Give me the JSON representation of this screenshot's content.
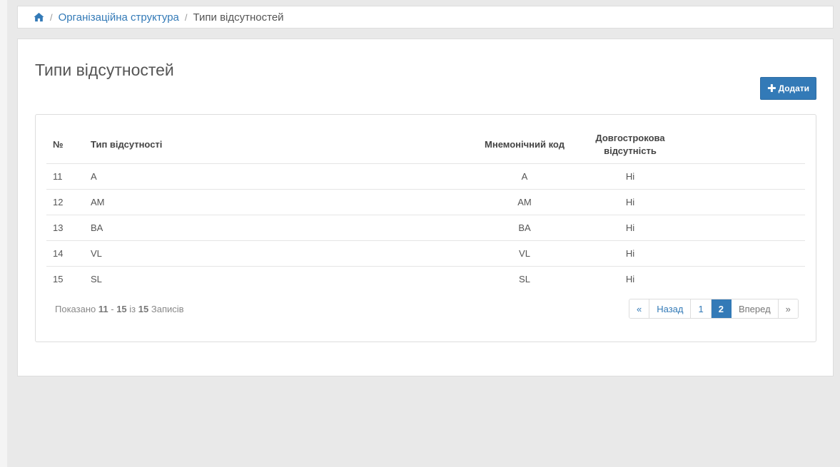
{
  "breadcrumb": {
    "home_icon": "home-icon",
    "separator": "/",
    "items": [
      "Організаційна структура",
      "Типи відсутностей"
    ]
  },
  "page": {
    "title": "Типи відсутностей",
    "add_button": {
      "icon": "plus-icon",
      "label": "Додати"
    }
  },
  "table": {
    "columns": [
      "№",
      "Тип відсутності",
      "Мнемонічний код",
      "Довгострокова відсутність"
    ],
    "rows": [
      [
        "11",
        "A",
        "A",
        "Ні"
      ],
      [
        "12",
        "AM",
        "AM",
        "Ні"
      ],
      [
        "13",
        "BA",
        "BA",
        "Ні"
      ],
      [
        "14",
        "VL",
        "VL",
        "Ні"
      ],
      [
        "15",
        "SL",
        "SL",
        "Ні"
      ]
    ]
  },
  "info": {
    "prefix": "Показано",
    "from": "11",
    "dash": "-",
    "to": "15",
    "of": "із",
    "total": "15",
    "suffix": "Записів"
  },
  "pagination": {
    "first": "«",
    "prev": "Назад",
    "pages": [
      "1",
      "2"
    ],
    "active_page": "2",
    "next": "Вперед",
    "last": "»"
  },
  "colors": {
    "accent": "#337ab7",
    "background": "#e9e9e9",
    "panel": "#ffffff"
  }
}
